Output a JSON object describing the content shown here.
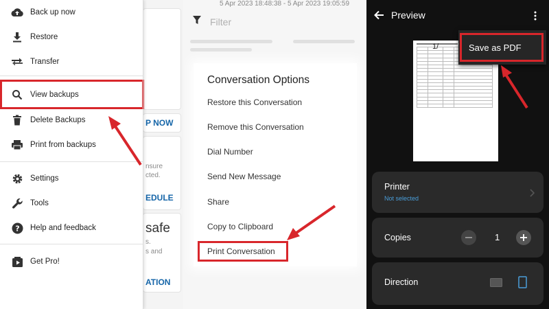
{
  "drawer": {
    "items": [
      {
        "label": "Back up now",
        "icon": "cloud-upload-icon"
      },
      {
        "label": "Restore",
        "icon": "download-icon"
      },
      {
        "label": "Transfer",
        "icon": "transfer-icon"
      },
      {
        "label": "View backups",
        "icon": "search-icon"
      },
      {
        "label": "Delete Backups",
        "icon": "trash-icon"
      },
      {
        "label": "Print from backups",
        "icon": "printer-icon"
      },
      {
        "label": "Settings",
        "icon": "gear-icon"
      },
      {
        "label": "Tools",
        "icon": "wrench-icon"
      },
      {
        "label": "Help and feedback",
        "icon": "help-icon"
      },
      {
        "label": "Get Pro!",
        "icon": "play-box-icon"
      }
    ],
    "background": {
      "backup_now_text": "P NOW",
      "ensure_text": "nsure",
      "cted_text": "cted.",
      "schedule_text": "EDULE",
      "safe_text": "safe",
      "s_text": "s.",
      "s_and_text": "s and",
      "ation_text": "ATION"
    }
  },
  "conversation": {
    "date_range": "5 Apr 2023 18:48:38 - 5 Apr 2023 19:05:59",
    "filter_label": "Filter",
    "dialog_title": "Conversation Options",
    "options": [
      "Restore this Conversation",
      "Remove this Conversation",
      "Dial Number",
      "Send New Message",
      "Share",
      "Copy to Clipboard",
      "Print Conversation"
    ]
  },
  "preview": {
    "title": "Preview",
    "doc_fragment": "1/",
    "menu_item": "Save as PDF",
    "printer_label": "Printer",
    "printer_status": "Not selected",
    "copies_label": "Copies",
    "copies_value": "1",
    "direction_label": "Direction"
  },
  "colors": {
    "highlight": "#d8262b",
    "accent_blue": "#1565a8",
    "dark_bg": "#111111",
    "card_bg": "#2a2a2a"
  }
}
